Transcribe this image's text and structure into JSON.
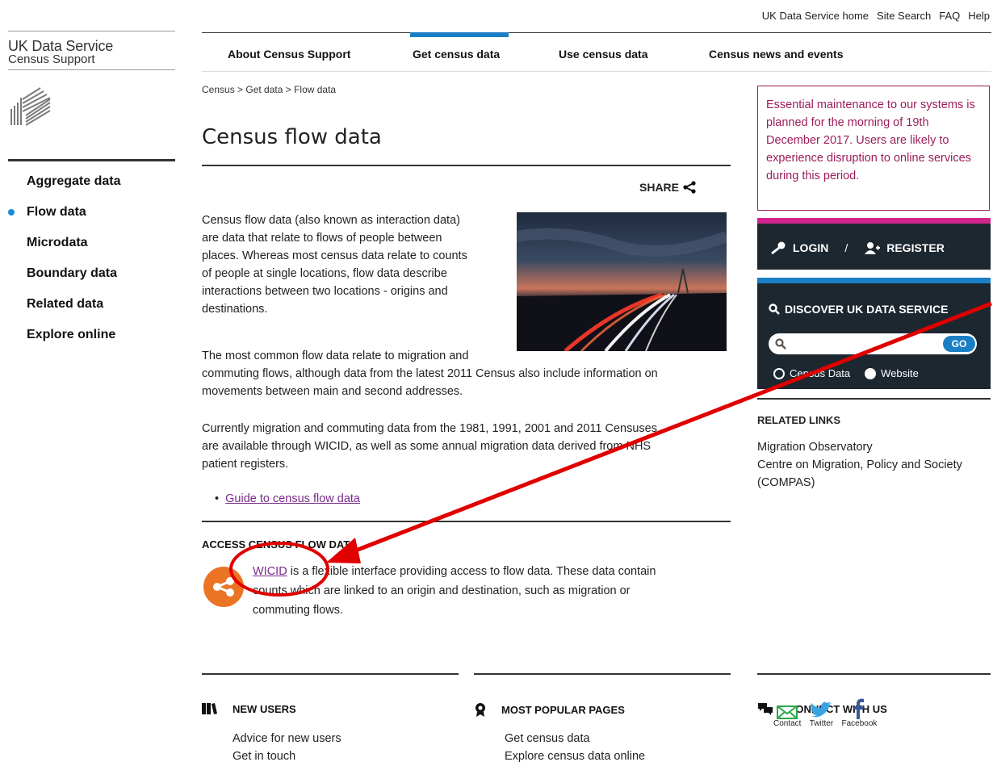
{
  "utility_links": [
    "UK Data Service home",
    "Site Search",
    "FAQ",
    "Help"
  ],
  "brand": {
    "name": "UK Data Service",
    "sub": "Census Support"
  },
  "left_nav": [
    {
      "label": "Aggregate data",
      "active": false
    },
    {
      "label": "Flow data",
      "active": true
    },
    {
      "label": "Microdata",
      "active": false
    },
    {
      "label": "Boundary data",
      "active": false
    },
    {
      "label": "Related data",
      "active": false
    },
    {
      "label": "Explore online",
      "active": false
    }
  ],
  "top_nav": [
    {
      "label": "About Census Support",
      "active": false
    },
    {
      "label": "Get census data",
      "active": true
    },
    {
      "label": "Use census data",
      "active": false
    },
    {
      "label": "Census news and events",
      "active": false
    }
  ],
  "breadcrumb": "Census > Get data > Flow data",
  "page_title": "Census flow data",
  "share_label": "SHARE",
  "content": {
    "p1_lines": [
      "Census flow data (also known as interaction data)",
      "are data that relate to flows of people between",
      "places. Whereas most census data relate to counts",
      "of people at single locations, flow data describe",
      "interactions between two locations - origins and",
      "destinations."
    ],
    "p2_lines": [
      "The most common flow data relate to migration and",
      "commuting flows, although data from the latest 2011 Census also include information on",
      "movements between main and second addresses."
    ],
    "p3_lines": [
      "Currently migration and commuting data from the 1981, 1991, 2001 and 2011 Censuses",
      "are available through WICID, as well as some annual migration data derived from NHS",
      "patient registers."
    ],
    "guide_link": "Guide to census flow data",
    "access_heading": "ACCESS CENSUS FLOW DATA",
    "wicid_link": "WICID",
    "wicid_rest_line1": " is a flexible interface providing access to flow data. These data contain",
    "wicid_line2": "counts which are linked to an origin and destination, such as migration or",
    "wicid_line3": "commuting flows."
  },
  "notice_text": "Essential maintenance to our systems is planned for the morning of 19th December 2017. Users are likely to experience disruption to online services during this period.",
  "login": {
    "login_label": "LOGIN",
    "separator": "/",
    "register_label": "REGISTER"
  },
  "discover": {
    "heading": "DISCOVER UK DATA SERVICE",
    "go_label": "GO",
    "search_value": "",
    "option_census": "Census Data",
    "option_website": "Website",
    "selected": "Website"
  },
  "related": {
    "heading": "RELATED LINKS",
    "links": [
      "Migration Observatory",
      "Centre on Migration, Policy and Society (COMPAS)"
    ]
  },
  "footer": {
    "new_users": {
      "heading": "NEW USERS",
      "links": [
        "Advice for new users",
        "Get in touch"
      ]
    },
    "popular": {
      "heading": "MOST POPULAR PAGES",
      "links": [
        "Get census data",
        "Explore census data online"
      ]
    },
    "connect": {
      "heading": "CONNECT WITH US",
      "social": [
        "Contact",
        "Twitter",
        "Facebook"
      ]
    }
  },
  "colors": {
    "accent_blue": "#1a7fc4",
    "notice_magenta": "#9c1d5a",
    "login_pink": "#d1248c",
    "dark_panel": "#1c2730",
    "wicid_orange": "#ea7424",
    "link_purple": "#7a2a8c",
    "annotation_red": "#e00000"
  }
}
